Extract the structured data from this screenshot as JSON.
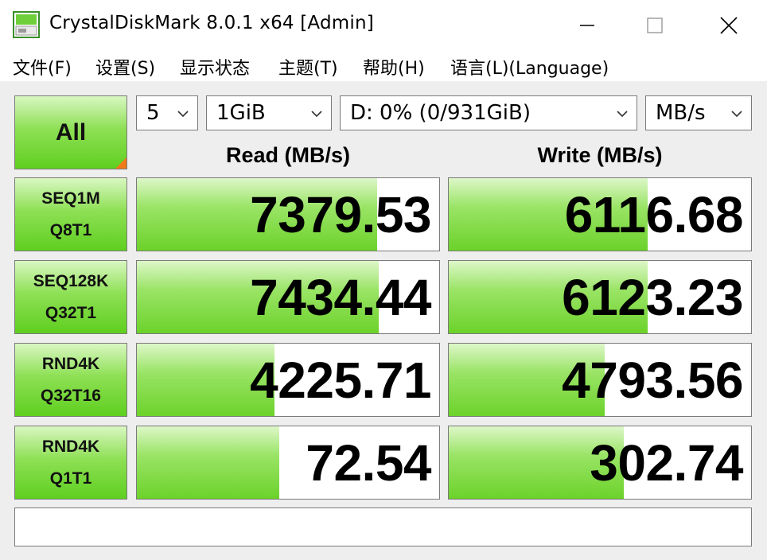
{
  "window": {
    "title": "CrystalDiskMark 8.0.1 x64 [Admin]"
  },
  "menu": [
    {
      "id": "file",
      "label": "文件(F)"
    },
    {
      "id": "settings",
      "label": "设置(S)"
    },
    {
      "id": "display",
      "label": "显示状态"
    },
    {
      "id": "theme",
      "label": "主题(T)"
    },
    {
      "id": "help",
      "label": "帮助(H)"
    },
    {
      "id": "language",
      "label": "语言(L)(Language)"
    }
  ],
  "controls": {
    "all_label": "All",
    "count": "5",
    "size": "1GiB",
    "drive": "D: 0% (0/931GiB)",
    "unit": "MB/s"
  },
  "headers": {
    "read": "Read (MB/s)",
    "write": "Write (MB/s)"
  },
  "max_scale_mbps": 9300,
  "tests": [
    {
      "line1": "SEQ1M",
      "line2": "Q8T1",
      "read": "7379.53",
      "write": "6116.68",
      "read_value": 7379.53,
      "write_value": 6116.68
    },
    {
      "line1": "SEQ128K",
      "line2": "Q32T1",
      "read": "7434.44",
      "write": "6123.23",
      "read_value": 7434.44,
      "write_value": 6123.23
    },
    {
      "line1": "RND4K",
      "line2": "Q32T16",
      "read": "4225.71",
      "write": "4793.56",
      "read_value": 4225.71,
      "write_value": 4793.56
    },
    {
      "line1": "RND4K",
      "line2": "Q1T1",
      "read": "72.54",
      "write": "302.74",
      "read_bar_fraction": 0.47,
      "write_bar_fraction": 0.58
    }
  ],
  "colors": {
    "bar_green": "#6cd22a",
    "corner_orange": "#f07a1a",
    "border": "#7a7a7a"
  },
  "status": ""
}
